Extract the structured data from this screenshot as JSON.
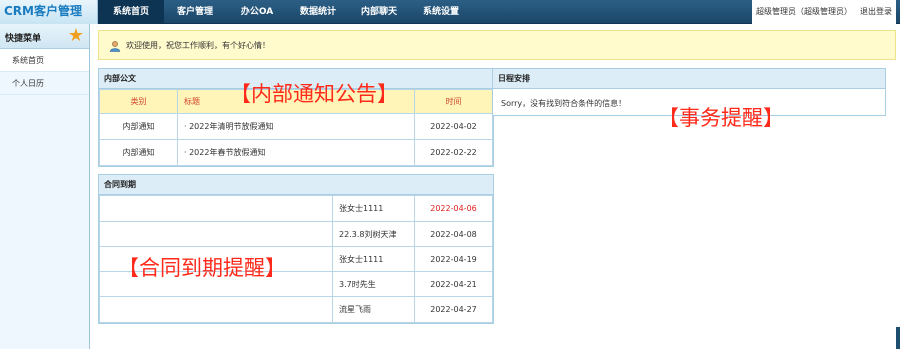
{
  "app": {
    "brand": "CRM客户管理"
  },
  "nav": [
    {
      "label": "系统首页",
      "active": true
    },
    {
      "label": "客户管理",
      "active": false
    },
    {
      "label": "办公OA",
      "active": false
    },
    {
      "label": "数据统计",
      "active": false
    },
    {
      "label": "内部聊天",
      "active": false
    },
    {
      "label": "系统设置",
      "active": false
    }
  ],
  "topRight": {
    "user": "超级管理员（超级管理员）",
    "logout": "退出登录"
  },
  "sidebar": {
    "title": "快捷菜单",
    "items": [
      {
        "label": "系统首页",
        "active": true
      },
      {
        "label": "个人日历",
        "active": false
      }
    ]
  },
  "welcome": {
    "text": "欢迎使用，祝您工作顺利，有个好心情！"
  },
  "notices": {
    "title": "内部公文",
    "headers": {
      "type": "类别",
      "title": "标题",
      "time": "时间"
    },
    "rows": [
      {
        "type": "内部通知",
        "title": "· 2022年清明节放假通知",
        "time": "2022-04-02"
      },
      {
        "type": "内部通知",
        "title": "· 2022年春节放假通知",
        "time": "2022-02-22"
      }
    ],
    "overlay": "【内部通知公告】"
  },
  "schedule": {
    "title": "日程安排",
    "empty": "Sorry，没有找到符合条件的信息！",
    "overlay": "【事务提醒】"
  },
  "contracts": {
    "title": "合同到期",
    "rows": [
      {
        "name": "张女士1111",
        "date": "2022-04-06",
        "highlight": true
      },
      {
        "name": "22.3.8刘树天津",
        "date": "2022-04-08",
        "highlight": false
      },
      {
        "name": "张女士1111",
        "date": "2022-04-19",
        "highlight": false
      },
      {
        "name": "3.7时先生",
        "date": "2022-04-21",
        "highlight": false
      },
      {
        "name": "流星飞雨",
        "date": "2022-04-27",
        "highlight": false
      }
    ],
    "overlay": "【合同到期提醒】"
  },
  "colors": {
    "nav": "#1b4668",
    "accent": "#1a7cc0",
    "highlight": "#e02020",
    "overlay": "#ff2a1a"
  }
}
